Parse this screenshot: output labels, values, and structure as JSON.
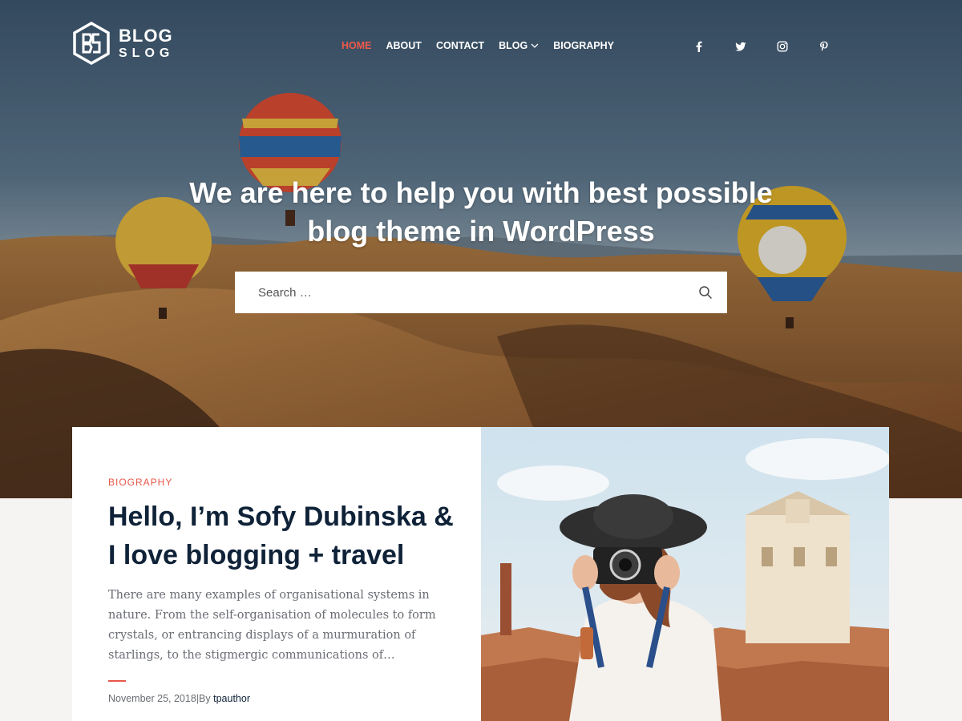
{
  "brand": {
    "line1": "BLOG",
    "line2": "SLOG",
    "accent_color": "#f0594b",
    "dark_text_color": "#0f2238"
  },
  "nav": {
    "items": [
      {
        "label": "HOME",
        "active": true
      },
      {
        "label": "ABOUT",
        "active": false
      },
      {
        "label": "CONTACT",
        "active": false
      },
      {
        "label": "BLOG",
        "active": false,
        "dropdown": true
      },
      {
        "label": "BIOGRAPHY",
        "active": false
      }
    ]
  },
  "social": [
    "facebook-icon",
    "twitter-icon",
    "instagram-icon",
    "pinterest-icon"
  ],
  "hero": {
    "title": "We are here to help you with best possible blog theme in WordPress",
    "search_placeholder": "Search …"
  },
  "featured_post": {
    "category": "BIOGRAPHY",
    "title": "Hello, I’m Sofy Dubinska & I love blogging + travel",
    "excerpt": "There are many examples of organisational systems in nature. From the self-organisation of molecules to form crystals, or entrancing displays of a murmuration of starlings, to the stigmergic communications of…",
    "date": "November 25, 2018",
    "by_label": "|By",
    "author": "tpauthor"
  }
}
